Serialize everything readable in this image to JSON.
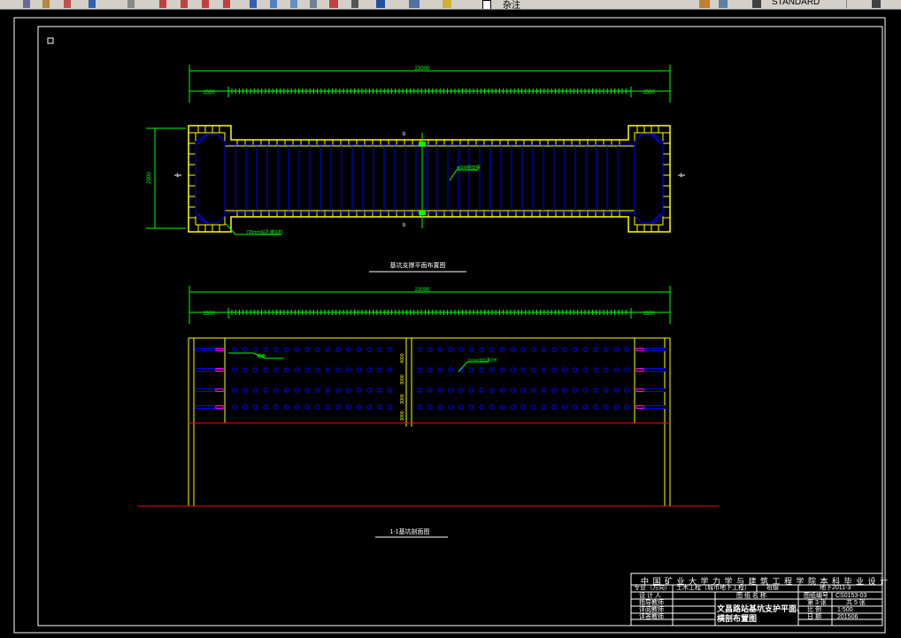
{
  "toolbar": {
    "layer_name": "杂注",
    "style_name": "STANDARD"
  },
  "drawing": {
    "plan": {
      "overall_dim": "23000",
      "left_dim": "1550",
      "right_dim": "1550",
      "height_dim": "2800",
      "section_mark": "b",
      "section_end": "1",
      "strut_note": "φ609钢支撑",
      "column_note": "700mm钻孔灌注桩",
      "caption": "基坑支撑平面布置图"
    },
    "section": {
      "overall_dim": "23000",
      "left_dim": "1550",
      "right_dim": "1550",
      "row_dims": [
        "4000",
        "3000",
        "3000",
        "3000"
      ],
      "anchor_note": "锚索",
      "pile_note": "700mm钻孔灌注桩",
      "caption": "1-1基坑剖面图"
    }
  },
  "title_block": {
    "school": "中 国 矿 业 大 学 力 学 与 建 筑 工 程 学 院 本 科 毕 业 设 计",
    "specialty_label": "专业（方向）",
    "specialty_value": "土木工程（城市地下工程）",
    "class_label": "班级",
    "class_value": "地下2011-3",
    "designer_label": "设 计 人",
    "drawing_name_label": "图 纸 名 称",
    "drawing_no_label": "图纸编号",
    "drawing_no_value": "CS0153-03",
    "advisor_label": "指导教师",
    "reviewer_label": "评阅教师",
    "defense_label": "评答教师",
    "drawing_title_line1": "文昌路站基坑支护平面、",
    "drawing_title_line2": "横剖布置图",
    "sheet_label": "第 3 张",
    "total_label": "共 5 张",
    "scale_label": "比 例",
    "scale_value": "1:500",
    "date_label": "日 期",
    "date_value": "201506"
  },
  "colors": {
    "frame": "#ffffff",
    "wall": "#ffff00",
    "dimension": "#00ff00",
    "strut": "#0000ff",
    "ground": "#ff0000",
    "anchor": "#ff00ff"
  }
}
